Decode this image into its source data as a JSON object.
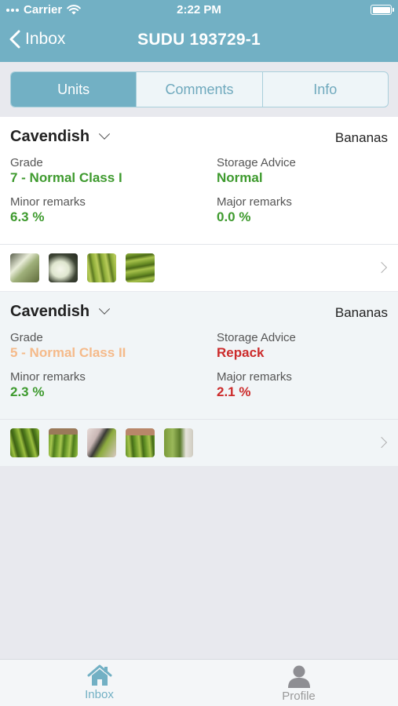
{
  "status_bar": {
    "carrier": "Carrier",
    "time": "2:22 PM"
  },
  "nav": {
    "back_label": "Inbox",
    "title": "SUDU 193729-1"
  },
  "tabs": [
    {
      "label": "Units",
      "active": true
    },
    {
      "label": "Comments",
      "active": false
    },
    {
      "label": "Info",
      "active": false
    }
  ],
  "units": [
    {
      "variety": "Cavendish",
      "product": "Bananas",
      "grade_label": "Grade",
      "grade_value": "7 - Normal Class I",
      "storage_label": "Storage Advice",
      "storage_value": "Normal",
      "minor_label": "Minor remarks",
      "minor_value": "6.3 %",
      "major_label": "Major remarks",
      "major_value": "0.0 %",
      "photo_count": 4
    },
    {
      "variety": "Cavendish",
      "product": "Bananas",
      "grade_label": "Grade",
      "grade_value": "5 - Normal Class II",
      "storage_label": "Storage Advice",
      "storage_value": "Repack",
      "minor_label": "Minor remarks",
      "minor_value": "2.3 %",
      "major_label": "Major remarks",
      "major_value": "2.1 %",
      "photo_count": 5
    }
  ],
  "tab_bar": [
    {
      "label": "Inbox",
      "icon": "home-icon",
      "active": true
    },
    {
      "label": "Profile",
      "icon": "person-icon",
      "active": false
    }
  ],
  "colors": {
    "accent": "#72b0c4",
    "good": "#3e9a2e",
    "warn": "#f5ba8a",
    "bad": "#cc2b2b"
  }
}
